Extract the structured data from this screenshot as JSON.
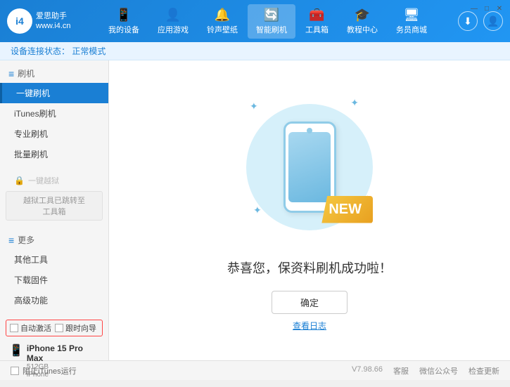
{
  "app": {
    "logo_text_line1": "爱思助手",
    "logo_text_line2": "www.i4.cn",
    "logo_symbol": "i4"
  },
  "nav": {
    "items": [
      {
        "id": "my-device",
        "icon": "📱",
        "label": "我的设备"
      },
      {
        "id": "apps-games",
        "icon": "👤",
        "label": "应用游戏"
      },
      {
        "id": "ringtones",
        "icon": "🔔",
        "label": "铃声壁纸"
      },
      {
        "id": "smart-flash",
        "icon": "🔄",
        "label": "智能刷机",
        "active": true
      },
      {
        "id": "toolbox",
        "icon": "🧰",
        "label": "工具箱"
      },
      {
        "id": "tutorial",
        "icon": "🎓",
        "label": "教程中心"
      },
      {
        "id": "service",
        "icon": "🖥",
        "label": "务员商城"
      }
    ]
  },
  "status_bar": {
    "label": "设备连接状态：",
    "status": "正常模式"
  },
  "sidebar": {
    "section_flash": {
      "group_label": "刷机",
      "items": [
        {
          "id": "one-key-flash",
          "label": "一键刷机",
          "active": true
        },
        {
          "id": "itunes-flash",
          "label": "iTunes刷机"
        },
        {
          "id": "pro-flash",
          "label": "专业刷机"
        },
        {
          "id": "batch-flash",
          "label": "批量刷机"
        }
      ]
    },
    "section_disabled": {
      "label": "一键越狱"
    },
    "warning_text": "越狱工具已跳转至\n工具箱",
    "section_more": {
      "group_label": "更多",
      "items": [
        {
          "id": "other-tools",
          "label": "其他工具"
        },
        {
          "id": "download-fw",
          "label": "下载固件"
        },
        {
          "id": "advanced",
          "label": "高级功能"
        }
      ]
    },
    "auto_options": [
      {
        "id": "auto-activate",
        "label": "自动激活"
      },
      {
        "id": "timed-guide",
        "label": "跟时向导"
      }
    ],
    "device": {
      "name": "iPhone 15 Pro Max",
      "storage": "512GB",
      "type": "iPhone"
    }
  },
  "content": {
    "new_label": "NEW",
    "success_message": "恭喜您，保资料刷机成功啦！",
    "confirm_button": "确定",
    "log_link": "查看日志"
  },
  "footer": {
    "itunes_label": "阻止iTunes运行",
    "version": "V7.98.66",
    "links": [
      {
        "id": "home",
        "label": "客服"
      },
      {
        "id": "wechat",
        "label": "微信公众号"
      },
      {
        "id": "check-update",
        "label": "检查更新"
      }
    ]
  },
  "window_controls": {
    "minimize": "—",
    "maximize": "□",
    "close": "✕"
  }
}
